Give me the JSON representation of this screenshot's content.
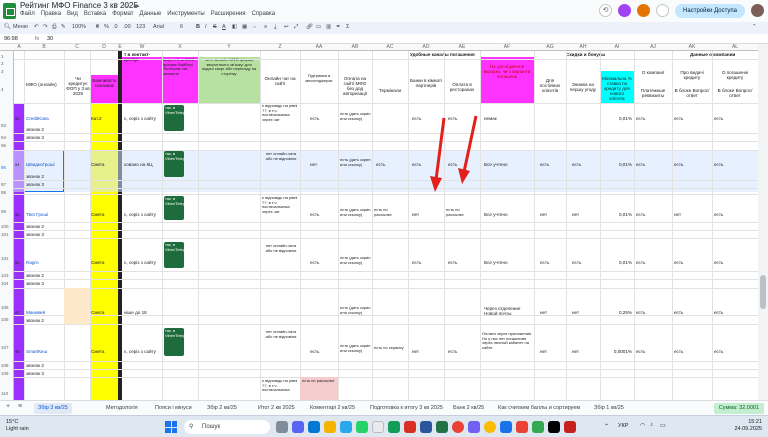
{
  "window": {
    "doc_title": "Рейтинг МФО Finance 3 кв 2025",
    "menu": [
      "Файл",
      "Правка",
      "Вид",
      "Вставка",
      "Формат",
      "Данные",
      "Инструменты",
      "Расширения",
      "Справка"
    ],
    "share_label": "Настройки Доступа"
  },
  "toolbar": {
    "menu_label": "Меню",
    "zoom": "100%",
    "font": "Arial",
    "size": "6"
  },
  "formula": {
    "cell_ref": "96:98",
    "value": "30"
  },
  "columns": [
    "A",
    "B",
    "C",
    "D",
    "E",
    "W",
    "X",
    "Y",
    "Z",
    "AA",
    "AB",
    "AC",
    "AD",
    "AE",
    "AF",
    "AG",
    "AH",
    "AI",
    "AJ",
    "AK",
    "AL"
  ],
  "rows": [
    "1",
    "2",
    "3",
    "4",
    "93",
    "94",
    "95",
    "96",
    "97",
    "98",
    "99",
    "100",
    "101",
    "102",
    "103",
    "104",
    "105",
    "106",
    "107",
    "108",
    "109",
    "110",
    "111",
    "112",
    "113",
    "114",
    "115",
    "116",
    "117"
  ],
  "headers": {
    "b": "МФО (онлайн)",
    "c": "Чи кредитує ФОП у 3 кв 2025",
    "d": "Важливість показник",
    "w": "т в контакт-центрі",
    "x": "якщо в 3 кв 2025 працює Вайбер/ Телеграм чат, зазначте",
    "y": "чи є на сайті МФО форма зворотнього зв’язку/ для подачі скарг або переходу на сторінку",
    "z": "Онлайн чат на сайті",
    "aa": "Підтримка в мессенджерах",
    "ab": "Оплата на сайті МФО без дод авторизації",
    "ac": "Термінали",
    "ad": "Банки в кімнаті партнерів",
    "ae": "Оплата в ресторанах",
    "af": "На дослідження вказати, чи з варіанти погашень",
    "ag": "Для постійних клієнтів",
    "ah": "Знижка на першу угоду",
    "ai": "Мінімальна % ставка по кредиту для нового клієнта",
    "aj": "О компанії",
    "ak": "Про видачі кредиту",
    "al": "О погашенні кредиту",
    "group_channels": "Удобные каналы погашения",
    "group_discounts": "Скидки и бонусы",
    "group_company": "Данные о компании",
    "aj2": "Платежные реквизиты",
    "ak2": "В блоке Вопрос/ответ",
    "al2": "В блоке Вопрос/ответ"
  },
  "records": [
    {
      "num": "93",
      "name": "CreditKasa",
      "sub": [
        "звонок 2",
        "звонок 3"
      ],
      "d_val": "Кат.2",
      "chip": "так, в Viber/Telegram",
      "z": "є відповідь на рівні ??, в т.ч. постачальника через чат",
      "aa": "есть",
      "ab": "есть (дать скрин или ссылку)",
      "ac": "",
      "ad": "есть",
      "ae": "есть",
      "af": "немає",
      "ag": "",
      "ah": "",
      "ai": "0,01%",
      "aj": "есть",
      "ak": "есть",
      "al": "есть"
    },
    {
      "num": "94",
      "name": "ШвидкоГроші",
      "sub": [
        "звонок 2",
        "звонок 3"
      ],
      "d_val": "Смета",
      "chip": "так, в Viber/Telegram",
      "z": "нет онлайн-чата або не відповіли",
      "aa": "нет",
      "ab": "есть (дать скрин или ссылку)",
      "ac": "есть",
      "ad": "есть",
      "ae": "есть",
      "af": "Все учтено",
      "ag": "есть",
      "ah": "есть",
      "ai": "0,01%",
      "aj": "есть",
      "ak": "есть",
      "al": "есть"
    },
    {
      "num": "95",
      "name": "Твої Гроші",
      "sub": [
        "звонок 2",
        "звонок 3"
      ],
      "d_val": "Смета",
      "chip": "так, в Viber/Telegram",
      "z": "є відповідь на рівні ??, в т.ч. постачальника через чат",
      "aa": "есть",
      "ab": "есть (дать скрин или ссылку)",
      "ac": "есть по рассылке",
      "ad": "нет",
      "ae": "есть по рассылке",
      "af": "Все учтено",
      "ag": "нет",
      "ah": "нет",
      "ai": "0,01%",
      "aj": "есть",
      "ak": "нет",
      "al": "есть"
    },
    {
      "num": "96",
      "name": "Ragro",
      "sub": [
        "звонок 2",
        "звонок 3"
      ],
      "d_val": "Смета",
      "chip": "так, в Viber/Telegram",
      "z": "нет онлайн-чата або не відповіли",
      "aa": "есть",
      "ab": "есть (дать скрин или ссылку)",
      "ac": "",
      "ad": "есть",
      "ae": "есть",
      "af": "Все учтено",
      "ag": "есть",
      "ah": "есть",
      "ai": "0,01%",
      "aj": "есть",
      "ak": "есть",
      "al": "есть"
    },
    {
      "num": "97",
      "name": "Манивей",
      "sub": [
        "звонок 2"
      ],
      "d_val": "Смета",
      "chip": "",
      "z": "",
      "aa": "",
      "ab": "есть (дать скрин или ссылку)",
      "ac": "",
      "ad": "",
      "ae": "",
      "af": "Через отделение Новой почты",
      "ag": "нет",
      "ah": "нет",
      "ai": "0,25%",
      "aj": "есть",
      "ak": "есть",
      "al": "есть"
    },
    {
      "num": "98",
      "name": "SmartКеш",
      "sub": [
        "звонок 2",
        "звонок 3"
      ],
      "d_val": "Смета",
      "chip": "так, в Viber/Telegram",
      "z": "нет онлайн-чата або не відповіли",
      "aa": "есть",
      "ab": "есть (дать скрин или ссылку)",
      "ac": "есть по сервису",
      "ad": "нет",
      "ae": "есть",
      "af": "Оплата через приложение. Но у нас нет погашения через личный кабинет на сайте",
      "ag": "нет",
      "ah": "нет",
      "ai": "0,0001%",
      "aj": "есть",
      "ak": "есть",
      "al": "есть"
    },
    {
      "num": "99",
      "name": "",
      "sub": [],
      "d_val": "",
      "chip": "",
      "z": "є відповідь на рівні ??, в т.ч. постачальника",
      "aa": "есть по рассылке",
      "ab": "",
      "ac": "",
      "ad": "",
      "ae": "",
      "af": "",
      "ag": "",
      "ah": "",
      "ai": "",
      "aj": "",
      "ak": "",
      "al": ""
    }
  ],
  "w_values": [
    "є, серіз з сайту",
    "ховано на КЦ",
    "є, серіз з сайту",
    "є, серіз з сайту",
    "ніше до 18",
    "є, серіз з сайту"
  ],
  "sheet_tabs": [
    "Збір 3 кв/25",
    "Методологія",
    "Пояси і мінуси",
    "Збір 2 кв/25",
    "Итог 2 кв 2025",
    "Коментарі 2 кв/25",
    "Подготовка к итогу 3 кв 2025",
    "Банк 2 кв/25",
    "Как считаем баллы и сортируем",
    "Збір 1 кв/25"
  ],
  "sum_label": "Сумма: 32,0001",
  "taskbar": {
    "temp": "15°C",
    "weather": "Light rain",
    "search": "Пошук",
    "lang": "УКР",
    "time": "15:21",
    "date": "24.09.2025"
  }
}
